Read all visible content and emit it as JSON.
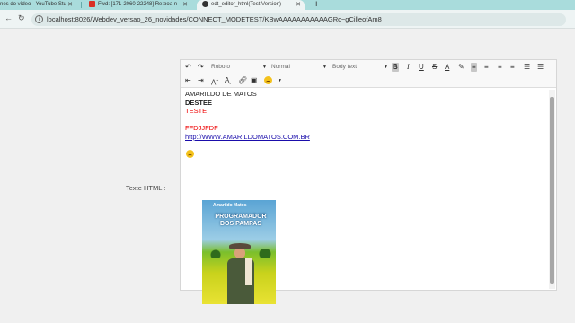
{
  "browser": {
    "tabs": [
      {
        "label": "nes do vídeo - YouTube Stu"
      },
      {
        "label": "Fwd: [171-2060-22248] Re:boa n"
      },
      {
        "label": "edt_editor_html(Test Version)"
      }
    ],
    "new_tab": "+",
    "url": "localhost:8026/Webdev_versao_26_novidades/CONNECT_MODETEST/KBwAAAAAAAAAAAGRc~gCilleofAm8",
    "accent": "#a9dcdc"
  },
  "page": {
    "field_label": "Texte HTML :"
  },
  "toolbar": {
    "font_family": "Roboto",
    "block_format": "Normal",
    "text_style": "Body text",
    "icons": [
      "undo-icon",
      "redo-icon",
      "bold-icon",
      "italic-icon",
      "underline-icon",
      "strikethrough-icon",
      "text-color-icon",
      "highlight-icon",
      "align-left-icon",
      "align-center-icon",
      "align-right-icon",
      "justify-icon",
      "numbered-list-icon",
      "bullet-list-icon",
      "outdent-icon",
      "indent-icon",
      "superscript-icon",
      "subscript-icon",
      "link-icon",
      "image-icon",
      "emoji-icon"
    ]
  },
  "content": {
    "line1": "AMARILDO DE MATOS",
    "line2": "DESTEE",
    "line3": "TESTE",
    "line4": "FFDJJFDF",
    "link": "http://WWW.AMARILDOMATOS.COM.BR",
    "cover": {
      "author": "Amarildo Matos",
      "title": "PROGRAMADOR DOS PAMPAS"
    }
  }
}
